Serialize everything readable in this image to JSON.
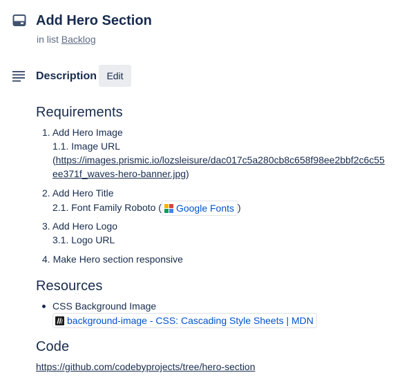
{
  "card": {
    "title": "Add Hero Section",
    "in_list_prefix": "in list",
    "list_name": "Backlog"
  },
  "description": {
    "heading": "Description",
    "edit_label": "Edit"
  },
  "requirements": {
    "heading": "Requirements",
    "items": [
      {
        "number": "1.",
        "label": "Add Hero Image",
        "sub_number": "1.1.",
        "sub_label": "Image URL",
        "url_line1": "https://images.prismic.io/lozsleisure/dac017c5a280cb8c658f98ee2bbf2c6c55",
        "url_line2": "ee371f_waves-hero-banner.jpg",
        "open_paren": "(",
        "close_paren": ")"
      },
      {
        "number": "2.",
        "label": "Add Hero Title",
        "sub_number": "2.1.",
        "sub_label": "Font Family Roboto (",
        "chip_label": "Google Fonts",
        "chip_icon": "google-fonts-icon",
        "close_paren": ")"
      },
      {
        "number": "3.",
        "label": "Add Hero Logo",
        "sub_number": "3.1.",
        "sub_label": "Logo URL"
      },
      {
        "number": "4.",
        "label": "Make Hero section responsive"
      }
    ]
  },
  "resources": {
    "heading": "Resources",
    "items": [
      {
        "label": "CSS Background Image",
        "chip_label": "background-image - CSS: Cascading Style Sheets | MDN",
        "chip_icon": "mdn-icon"
      }
    ]
  },
  "code": {
    "heading": "Code",
    "url": "https://github.com/codebyprojects/tree/hero-section"
  },
  "colors": {
    "text": "#172b4d",
    "muted": "#5e6c84",
    "link_blue": "#0052cc",
    "button_bg": "#ebecf0"
  }
}
